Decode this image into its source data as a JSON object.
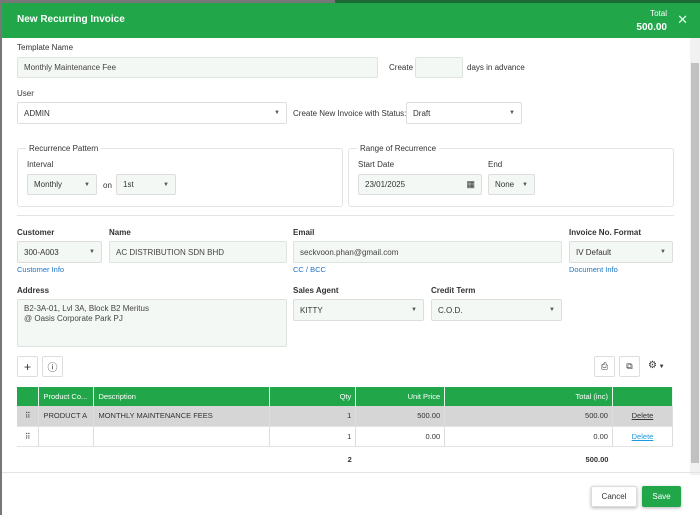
{
  "header": {
    "title": "New Recurring Invoice",
    "total_label": "Total",
    "total_value": "500.00"
  },
  "form": {
    "template_name_label": "Template Name",
    "template_name": "Monthly Maintenance Fee",
    "create_label": "Create",
    "create_days": "",
    "days_label": "days in advance",
    "user_label": "User",
    "user": "ADMIN",
    "status_label": "Create New Invoice with Status:",
    "status": "Draft",
    "recurrence": {
      "legend": "Recurrence Pattern",
      "interval_label": "Interval",
      "interval": "Monthly",
      "on_label": "on",
      "day": "1st"
    },
    "range": {
      "legend": "Range of Recurrence",
      "start_label": "Start Date",
      "start_date": "23/01/2025",
      "end_label": "End",
      "end": "None"
    },
    "customer_label": "Customer",
    "customer": "300-A003",
    "customer_info": "Customer Info",
    "name_label": "Name",
    "name": "AC DISTRIBUTION SDN BHD",
    "email_label": "Email",
    "email": "seckvoon.phan@gmail.com",
    "cc_bcc": "CC / BCC",
    "format_label": "Invoice No. Format",
    "format": "IV Default",
    "document_info": "Document Info",
    "address_label": "Address",
    "address_line1": "B2-3A-01, Lvl 3A, Block B2 Meritus",
    "address_line2": "@ Oasis Corporate Park PJ",
    "agent_label": "Sales Agent",
    "agent": "KITTY",
    "credit_label": "Credit Term",
    "credit": "C.O.D."
  },
  "table": {
    "headers": [
      "",
      "Product Co...",
      "Description",
      "Qty",
      "Unit Price",
      "Total (inc)",
      ""
    ],
    "rows": [
      {
        "code": "PRODUCT A",
        "description": "MONTHLY MAINTENANCE FEES",
        "qty": "1",
        "unit_price": "500.00",
        "total": "500.00",
        "action": "Delete"
      },
      {
        "code": "",
        "description": "",
        "qty": "1",
        "unit_price": "0.00",
        "total": "0.00",
        "action": "Delete"
      }
    ],
    "total_qty": "2",
    "grand_total": "500.00"
  },
  "footer": {
    "cancel": "Cancel",
    "save": "Save"
  },
  "colors": {
    "accent": "#22a64a",
    "link": "#1a73c7"
  }
}
